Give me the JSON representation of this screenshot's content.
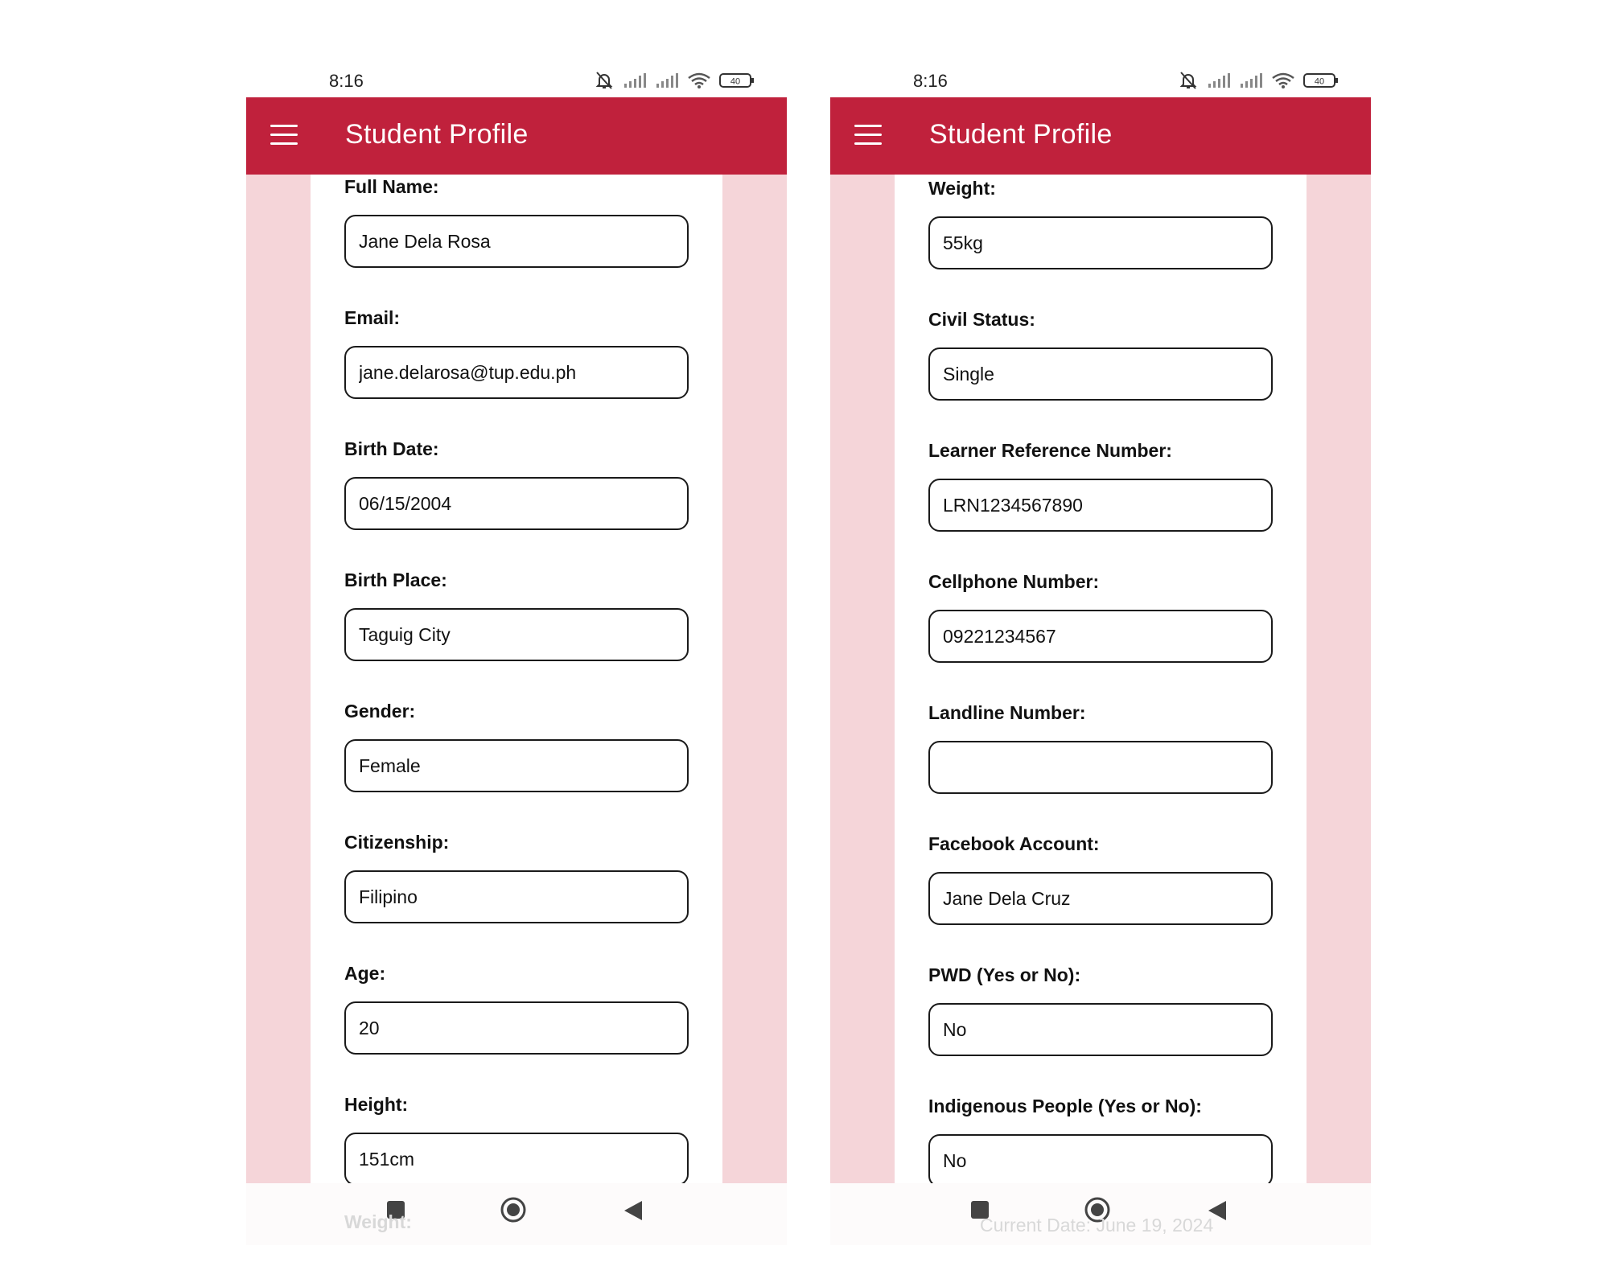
{
  "status_bar": {
    "time": "8:16",
    "battery": "40",
    "icons": [
      "bell-muted-icon",
      "signal-icon",
      "signal-icon",
      "wifi-icon",
      "battery-icon"
    ]
  },
  "colors": {
    "app_bar": "#c0213c",
    "page_background": "#f5d5d9",
    "card": "#ffffff"
  },
  "screens": [
    {
      "app_bar": {
        "title": "Student Profile",
        "menu_icon": "hamburger-menu-icon"
      },
      "fields": [
        {
          "label": "Full Name:",
          "value": "Jane Dela Rosa"
        },
        {
          "label": "Email:",
          "value": "jane.delarosa@tup.edu.ph"
        },
        {
          "label": "Birth Date:",
          "value": "06/15/2004"
        },
        {
          "label": "Birth Place:",
          "value": "Taguig City"
        },
        {
          "label": "Gender:",
          "value": "Female"
        },
        {
          "label": "Citizenship:",
          "value": "Filipino"
        },
        {
          "label": "Age:",
          "value": "20"
        },
        {
          "label": "Height:",
          "value": "151cm"
        }
      ],
      "partially_hidden_text": "Weight:"
    },
    {
      "app_bar": {
        "title": "Student Profile",
        "menu_icon": "hamburger-menu-icon"
      },
      "fields": [
        {
          "label": "Weight:",
          "value": "55kg"
        },
        {
          "label": "Civil Status:",
          "value": "Single"
        },
        {
          "label": "Learner Reference Number:",
          "value": "LRN1234567890"
        },
        {
          "label": "Cellphone Number:",
          "value": "09221234567"
        },
        {
          "label": "Landline Number:",
          "value": ""
        },
        {
          "label": "Facebook Account:",
          "value": "Jane Dela Cruz"
        },
        {
          "label": "PWD (Yes or No):",
          "value": "No"
        },
        {
          "label": "Indigenous People (Yes or No):",
          "value": "No"
        }
      ],
      "partially_hidden_text": "Current Date: June 19, 2024"
    }
  ],
  "nav_bar": {
    "icons": [
      "recent-apps-square-icon",
      "home-circle-icon",
      "back-triangle-icon"
    ]
  }
}
